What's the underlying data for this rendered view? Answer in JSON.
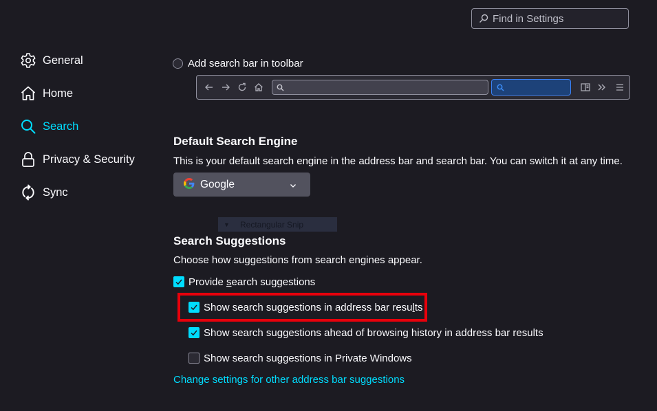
{
  "search": {
    "placeholder": "Find in Settings",
    "icon": "search-icon"
  },
  "sidebar": {
    "items": [
      {
        "label": "General",
        "icon": "gear-icon",
        "active": false
      },
      {
        "label": "Home",
        "icon": "home-icon",
        "active": false
      },
      {
        "label": "Search",
        "icon": "search-icon",
        "active": true
      },
      {
        "label": "Privacy & Security",
        "icon": "lock-icon",
        "active": false
      },
      {
        "label": "Sync",
        "icon": "sync-icon",
        "active": false
      }
    ]
  },
  "toolbar_option": {
    "label": "Add search bar in toolbar",
    "selected": false
  },
  "default_engine": {
    "heading": "Default Search Engine",
    "description": "This is your default search engine in the address bar and search bar. You can switch it at any time.",
    "selected": "Google"
  },
  "snip_overlay": {
    "label": "Rectangular Snip"
  },
  "suggestions": {
    "heading": "Search Suggestions",
    "description": "Choose how suggestions from search engines appear.",
    "provide": {
      "pre": "Provide ",
      "accel": "s",
      "post": "earch suggestions",
      "checked": true
    },
    "address_bar": {
      "pre": "Show search suggestions in address bar resu",
      "accel": "l",
      "post": "ts",
      "checked": true
    },
    "ahead_of_history": {
      "label": "Show search suggestions ahead of browsing history in address bar results",
      "checked": true
    },
    "private_windows": {
      "label": "Show search suggestions in Private Windows",
      "checked": false
    },
    "link": "Change settings for other address bar suggestions"
  },
  "colors": {
    "background": "#1c1b22",
    "accent": "#00ddff",
    "highlight_box": "#e8000b",
    "select_bg": "#52525e"
  }
}
